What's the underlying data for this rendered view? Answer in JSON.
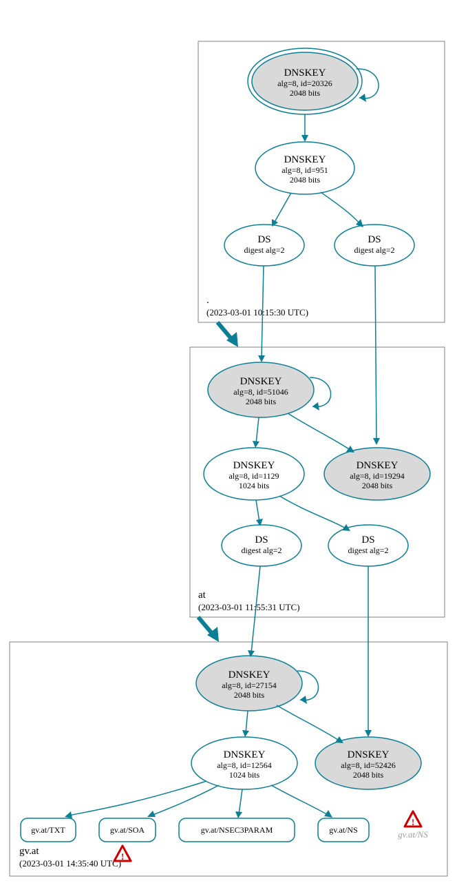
{
  "zones": {
    "root": {
      "label": ".",
      "timestamp": "(2023-03-01 10:15:30 UTC)"
    },
    "at": {
      "label": "at",
      "timestamp": "(2023-03-01 11:55:31 UTC)"
    },
    "gvat": {
      "label": "gv.at",
      "timestamp": "(2023-03-01 14:35:40 UTC)"
    }
  },
  "nodes": {
    "root_ksk": {
      "title": "DNSKEY",
      "line2": "alg=8, id=20326",
      "line3": "2048 bits"
    },
    "root_zsk": {
      "title": "DNSKEY",
      "line2": "alg=8, id=951",
      "line3": "2048 bits"
    },
    "root_ds1": {
      "title": "DS",
      "line2": "digest alg=2"
    },
    "root_ds2": {
      "title": "DS",
      "line2": "digest alg=2"
    },
    "at_ksk": {
      "title": "DNSKEY",
      "line2": "alg=8, id=51046",
      "line3": "2048 bits"
    },
    "at_zsk": {
      "title": "DNSKEY",
      "line2": "alg=8, id=1129",
      "line3": "1024 bits"
    },
    "at_key2": {
      "title": "DNSKEY",
      "line2": "alg=8, id=19294",
      "line3": "2048 bits"
    },
    "at_ds1": {
      "title": "DS",
      "line2": "digest alg=2"
    },
    "at_ds2": {
      "title": "DS",
      "line2": "digest alg=2"
    },
    "gv_ksk": {
      "title": "DNSKEY",
      "line2": "alg=8, id=27154",
      "line3": "2048 bits"
    },
    "gv_zsk": {
      "title": "DNSKEY",
      "line2": "alg=8, id=12564",
      "line3": "1024 bits"
    },
    "gv_key2": {
      "title": "DNSKEY",
      "line2": "alg=8, id=52426",
      "line3": "2048 bits"
    },
    "gv_txt": {
      "label": "gv.at/TXT"
    },
    "gv_soa": {
      "label": "gv.at/SOA"
    },
    "gv_nsec3": {
      "label": "gv.at/NSEC3PARAM"
    },
    "gv_ns": {
      "label": "gv.at/NS"
    },
    "gv_ns_warn": {
      "label": "gv.at/NS"
    }
  }
}
